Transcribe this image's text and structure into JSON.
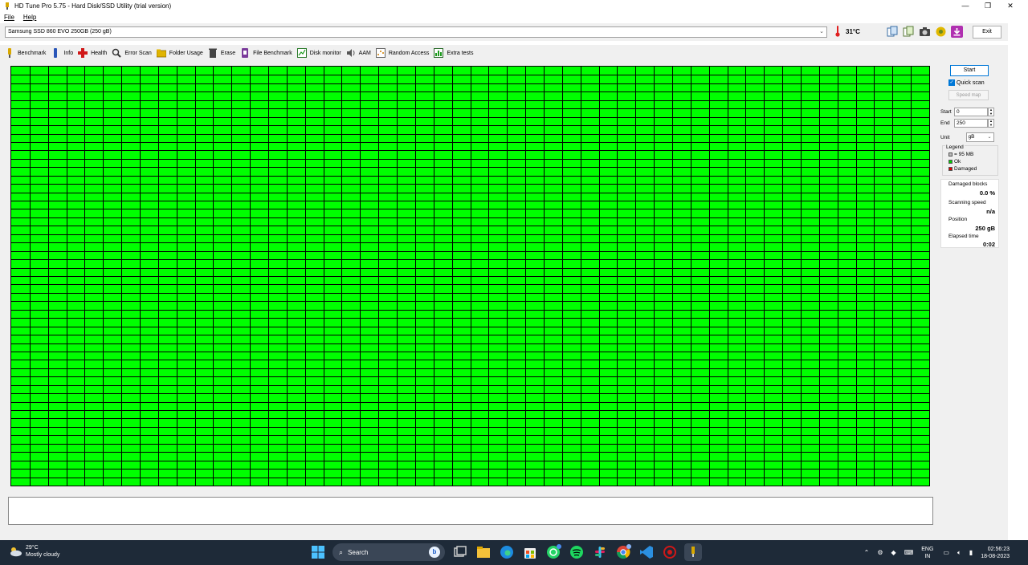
{
  "window": {
    "title": "HD Tune Pro 5.75 - Hard Disk/SSD Utility (trial version)",
    "controls": [
      "—",
      "❐",
      "✕"
    ]
  },
  "menu": [
    "File",
    "Help"
  ],
  "drive": {
    "selected": "Samsung SSD 860 EVO 250GB (250 gB)",
    "temperature": "31°C",
    "exit_label": "Exit"
  },
  "tabs": [
    {
      "label": "Benchmark",
      "icon": "benchmark-icon"
    },
    {
      "label": "Info",
      "icon": "info-icon"
    },
    {
      "label": "Health",
      "icon": "health-icon"
    },
    {
      "label": "Error Scan",
      "icon": "error-scan-icon"
    },
    {
      "label": "Folder Usage",
      "icon": "folder-icon"
    },
    {
      "label": "Erase",
      "icon": "erase-icon"
    },
    {
      "label": "File Benchmark",
      "icon": "file-benchmark-icon"
    },
    {
      "label": "Disk monitor",
      "icon": "disk-monitor-icon"
    },
    {
      "label": "AAM",
      "icon": "speaker-icon"
    },
    {
      "label": "Random Access",
      "icon": "random-access-icon"
    },
    {
      "label": "Extra tests",
      "icon": "extra-tests-icon"
    }
  ],
  "scan": {
    "columns": 50,
    "rows": 50,
    "block_status": "ok",
    "ok_color": "#00ff00",
    "damaged_color": "#e00000"
  },
  "controls": {
    "start_label": "Start",
    "quick_scan_label": "Quick scan",
    "quick_scan_checked": true,
    "speed_map_label": "Speed map",
    "start_field_label": "Start",
    "start_value": "0",
    "end_field_label": "End",
    "end_value": "250",
    "unit_label": "Unit",
    "unit_value": "gB"
  },
  "legend": {
    "title": "Legend",
    "block_size": "= 95 MB",
    "ok": "Ok",
    "damaged": "Damaged"
  },
  "stats": {
    "damaged_blocks_label": "Damaged blocks",
    "damaged_blocks_value": "0.0 %",
    "scanning_speed_label": "Scanning speed",
    "scanning_speed_value": "n/a",
    "position_label": "Position",
    "position_value": "250 gB",
    "elapsed_label": "Elapsed time",
    "elapsed_value": "0:02"
  },
  "taskbar": {
    "weather_temp": "29°C",
    "weather_desc": "Mostly cloudy",
    "search_placeholder": "Search",
    "lang_top": "ENG",
    "lang_bottom": "IN",
    "time": "02:56:23",
    "date": "18-08-2023"
  }
}
